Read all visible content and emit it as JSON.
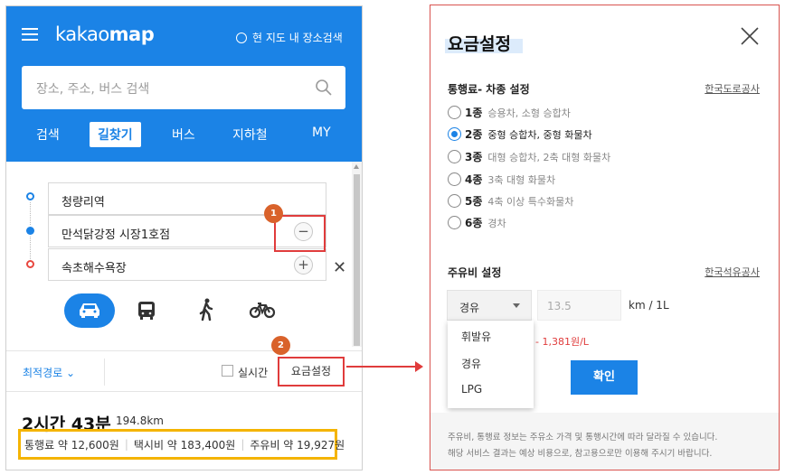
{
  "app": {
    "logo_light": "kakao",
    "logo_bold": "map",
    "map_search_label": "현 지도 내 장소검색",
    "search_placeholder": "장소, 주소, 버스 검색",
    "tabs": [
      {
        "label": "검색",
        "active": false
      },
      {
        "label": "길찾기",
        "active": true
      },
      {
        "label": "버스",
        "active": false
      },
      {
        "label": "지하철",
        "active": false
      },
      {
        "label": "MY",
        "active": false
      }
    ],
    "accent_color": "#1b83e6"
  },
  "route": {
    "origin": "청량리역",
    "waypoint": "만석닭강정 시장1호점",
    "destination": "속초해수욕장",
    "remove_waypoint_symbol": "−",
    "add_point_symbol": "+",
    "clear_symbol": "✕",
    "modes": [
      "car-icon",
      "bus-icon",
      "walk-icon",
      "bike-icon"
    ],
    "active_mode": "car"
  },
  "annotations": {
    "badge1": "1",
    "badge2": "2",
    "highlight_color": "#e03c3c"
  },
  "options": {
    "best_route_label": "최적경로",
    "realtime_label": "실시간",
    "realtime_checked": false,
    "fee_settings_label": "요금설정"
  },
  "summary": {
    "duration": "2시간 43분",
    "distance": "194.8km",
    "toll": "통행료 약 12,600원",
    "taxi": "택시비 약 183,400원",
    "fuel": "주유비 약 19,927원"
  },
  "fee_dialog": {
    "title": "요금설정",
    "toll_section": {
      "title": "통행료- 차종 설정",
      "link": "한국도로공사",
      "options": [
        {
          "label": "1종",
          "desc": "승용차, 소형 승합차",
          "selected": false
        },
        {
          "label": "2종",
          "desc": "중형 승합차, 중형 화물차",
          "selected": true
        },
        {
          "label": "3종",
          "desc": "대형 승합차, 2축 대형 화물차",
          "selected": false
        },
        {
          "label": "4종",
          "desc": "3축 대형 화물차",
          "selected": false
        },
        {
          "label": "5종",
          "desc": "4축 이상 특수화물차",
          "selected": false
        },
        {
          "label": "6종",
          "desc": "경차",
          "selected": false
        }
      ]
    },
    "fuel_section": {
      "title": "주유비 설정",
      "link": "한국석유공사",
      "fuel_type": "경유",
      "fuel_options": [
        "휘발유",
        "경유",
        "LPG"
      ],
      "efficiency_placeholder": "13.5",
      "unit": "km / 1L",
      "price_text": "1,381원/L",
      "price_prefix": "-"
    },
    "confirm_label": "확인",
    "notice_line1": "주유비, 통행료 정보는 주유소 가격 및 통행시간에 따라 달라질 수 있습니다.",
    "notice_line2": "해당 서비스 결과는 예상 비용으로, 참고용으로만 이용해 주시기 바랍니다."
  }
}
